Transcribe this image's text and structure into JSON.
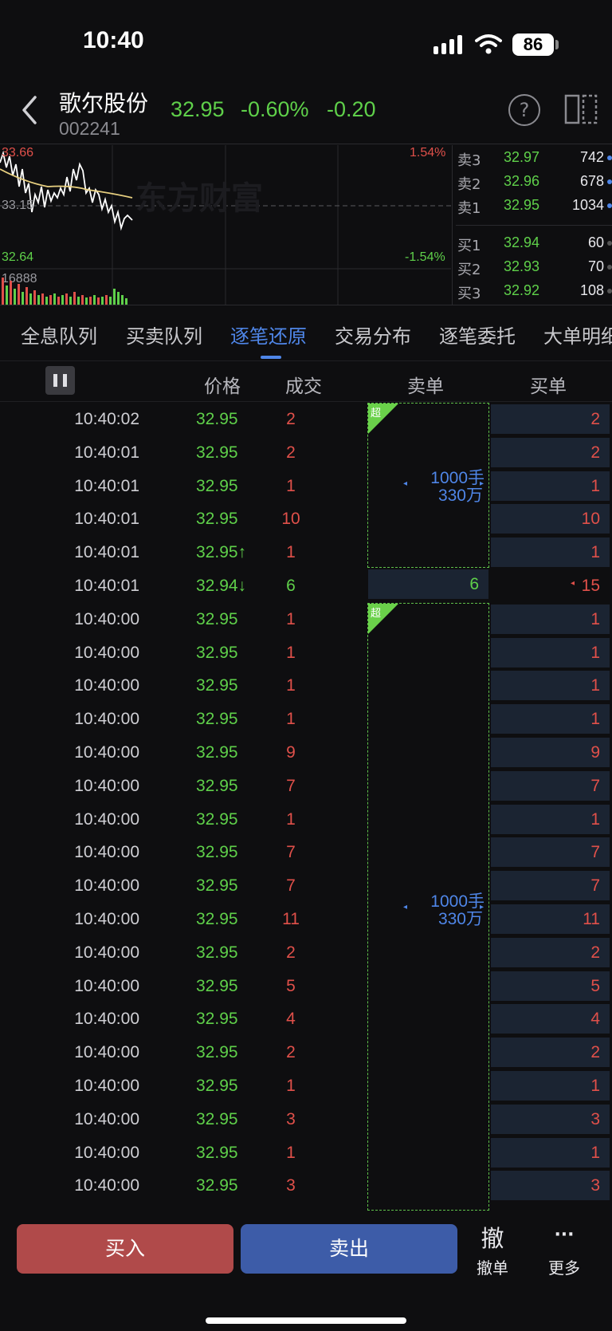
{
  "status_bar": {
    "time": "10:40",
    "battery": "86"
  },
  "header": {
    "name": "歌尔股份",
    "code": "002241",
    "price": "32.95",
    "change_pct": "-0.60%",
    "change": "-0.20"
  },
  "chart": {
    "high_price": "33.66",
    "mid_price": "33.15",
    "low_price": "32.64",
    "up_pct": "1.54%",
    "down_pct": "-1.54%",
    "volume_label": "16888",
    "watermark": "东方财富"
  },
  "order_book": {
    "asks": [
      {
        "label": "卖3",
        "price": "32.97",
        "vol": "742"
      },
      {
        "label": "卖2",
        "price": "32.96",
        "vol": "678"
      },
      {
        "label": "卖1",
        "price": "32.95",
        "vol": "1034"
      }
    ],
    "bids": [
      {
        "label": "买1",
        "price": "32.94",
        "vol": "60"
      },
      {
        "label": "买2",
        "price": "32.93",
        "vol": "70"
      },
      {
        "label": "买3",
        "price": "32.92",
        "vol": "108"
      }
    ]
  },
  "tabs": [
    "全息队列",
    "买卖队列",
    "逐笔还原",
    "交易分布",
    "逐笔委托",
    "大单明细"
  ],
  "columns": {
    "price": "价格",
    "deal": "成交",
    "sell": "卖单",
    "buy": "买单"
  },
  "trades": [
    {
      "time": "10:40:02",
      "price": "32.95",
      "vol": "2",
      "buy": "2"
    },
    {
      "time": "10:40:01",
      "price": "32.95",
      "vol": "2",
      "buy": "2"
    },
    {
      "time": "10:40:01",
      "price": "32.95",
      "vol": "1",
      "buy": "1"
    },
    {
      "time": "10:40:01",
      "price": "32.95",
      "vol": "10",
      "buy": "10"
    },
    {
      "time": "10:40:01",
      "price": "32.95↑",
      "vol": "1",
      "buy": "1"
    },
    {
      "time": "10:40:01",
      "price": "32.94↓",
      "vol": "6",
      "sell": "6",
      "buy": "15"
    },
    {
      "time": "10:40:00",
      "price": "32.95",
      "vol": "1",
      "buy": "1"
    },
    {
      "time": "10:40:00",
      "price": "32.95",
      "vol": "1",
      "buy": "1"
    },
    {
      "time": "10:40:00",
      "price": "32.95",
      "vol": "1",
      "buy": "1"
    },
    {
      "time": "10:40:00",
      "price": "32.95",
      "vol": "1",
      "buy": "1"
    },
    {
      "time": "10:40:00",
      "price": "32.95",
      "vol": "9",
      "buy": "9"
    },
    {
      "time": "10:40:00",
      "price": "32.95",
      "vol": "7",
      "buy": "7"
    },
    {
      "time": "10:40:00",
      "price": "32.95",
      "vol": "1",
      "buy": "1"
    },
    {
      "time": "10:40:00",
      "price": "32.95",
      "vol": "7",
      "buy": "7"
    },
    {
      "time": "10:40:00",
      "price": "32.95",
      "vol": "7",
      "buy": "7"
    },
    {
      "time": "10:40:00",
      "price": "32.95",
      "vol": "11",
      "buy": "11"
    },
    {
      "time": "10:40:00",
      "price": "32.95",
      "vol": "2",
      "buy": "2"
    },
    {
      "time": "10:40:00",
      "price": "32.95",
      "vol": "5",
      "buy": "5"
    },
    {
      "time": "10:40:00",
      "price": "32.95",
      "vol": "4",
      "buy": "4"
    },
    {
      "time": "10:40:00",
      "price": "32.95",
      "vol": "2",
      "buy": "2"
    },
    {
      "time": "10:40:00",
      "price": "32.95",
      "vol": "1",
      "buy": "1"
    },
    {
      "time": "10:40:00",
      "price": "32.95",
      "vol": "3",
      "buy": "3"
    },
    {
      "time": "10:40:00",
      "price": "32.95",
      "vol": "1",
      "buy": "1"
    },
    {
      "time": "10:40:00",
      "price": "32.95",
      "vol": "3",
      "buy": "3"
    }
  ],
  "sell_blocks": [
    {
      "tag": "超",
      "qty": "1000手",
      "amount": "330万"
    },
    {
      "tag": "超",
      "qty": "1000手",
      "amount": "330万"
    }
  ],
  "bottom": {
    "buy": "买入",
    "sell": "卖出",
    "cancel_icon": "撤",
    "cancel": "撤单",
    "more_icon": "···",
    "more": "更多"
  },
  "colors": {
    "up": "#e0504a",
    "down": "#5fd04a",
    "accent": "#4f86e8",
    "buy_button": "#b04a4a",
    "sell_button": "#3d5ca8"
  }
}
